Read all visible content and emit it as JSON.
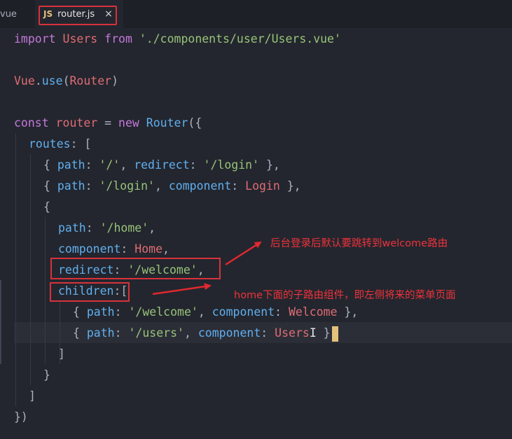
{
  "tabs": [
    {
      "label": "vue",
      "active": false
    },
    {
      "label": "router.js",
      "active": true,
      "icon_text": "JS",
      "close_glyph": "×"
    }
  ],
  "code": {
    "line_import": {
      "kw1": "import",
      "name": "Users",
      "kw2": "from",
      "path": "'./components/user/Users.vue'"
    },
    "line_use": {
      "obj": "Vue",
      "dot": ".",
      "method": "use",
      "open": "(",
      "arg": "Router",
      "close": ")"
    },
    "line_const": {
      "kw": "const",
      "name": "router",
      "eq": "=",
      "kw_new": "new",
      "cls": "Router",
      "open": "({"
    },
    "line_routes": {
      "key": "routes",
      "rest": ": ["
    },
    "route1": {
      "open": "{ ",
      "key1": "path",
      "val1": "'/'",
      "key2": "redirect",
      "val2": "'/login'",
      "close": " },"
    },
    "route2": {
      "open": "{ ",
      "key1": "path",
      "val1": "'/login'",
      "key2": "component",
      "val2": "Login",
      "close": " },"
    },
    "route3_open": "{",
    "route3_path": {
      "key": "path",
      "val": "'/home'"
    },
    "route3_component": {
      "key": "component",
      "val": "Home"
    },
    "route3_redirect": {
      "key": "redirect",
      "val": "'/welcome'"
    },
    "route3_children": {
      "key": "children",
      "rest": ":",
      "bracket": "["
    },
    "child1": {
      "open": "{ ",
      "key1": "path",
      "val1": "'/welcome'",
      "key2": "component",
      "val2": "Welcome",
      "close": " },"
    },
    "child2": {
      "open": "{",
      "key1": "path",
      "val1": "'/users'",
      "key2": "component",
      "val2": "Users",
      "ibeam": "I",
      "close": " }"
    },
    "children_close": "]",
    "route3_close": "}",
    "routes_close": "]",
    "router_close": "})"
  },
  "annotations": {
    "redirect_note": "后台登录后默认要跳转到welcome路由",
    "children_note": "home下面的子路由组件，即左侧将来的菜单页面"
  },
  "colors": {
    "keyword": "#c678dd",
    "variable": "#e06c75",
    "function": "#61afef",
    "string": "#98c379",
    "annotation": "#f0323c",
    "cursor": "#e5c07b"
  }
}
